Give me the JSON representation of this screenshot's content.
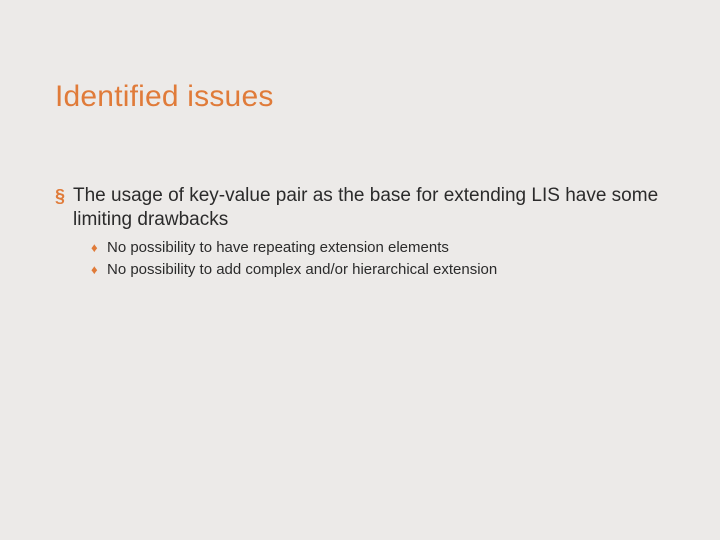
{
  "title": "Identified issues",
  "bullet_glyph_l1": "§",
  "bullet_glyph_l2": "♦",
  "main": {
    "text": "The usage of key-value pair as the base for extending LIS have some limiting drawbacks",
    "subs": {
      "0": "No possibility to have repeating extension elements",
      "1": "No possibility to add complex and/or hierarchical extension"
    }
  }
}
